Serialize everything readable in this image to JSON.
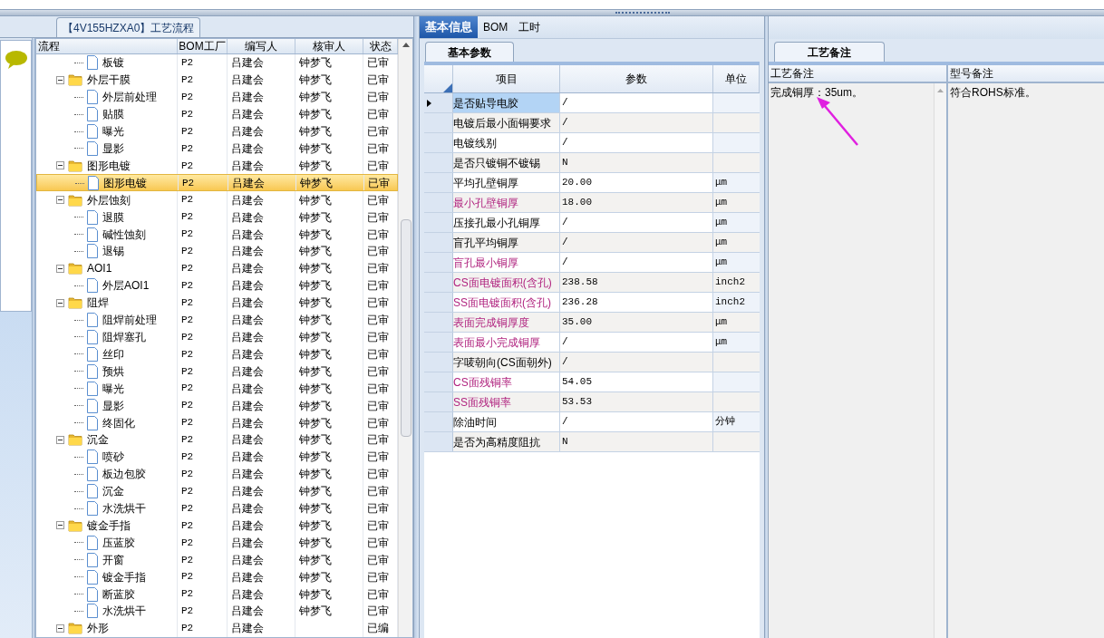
{
  "left_panel": {
    "title": "【4V155HZXA0】工艺流程",
    "columns": [
      "流程",
      "BOM工厂",
      "编写人",
      "核审人",
      "状态"
    ],
    "tree": [
      {
        "children": [
          {
            "label": "板镀",
            "factory": "P2",
            "writer": "吕建会",
            "reviewer": "钟梦飞",
            "status": "已审",
            "selected": false
          }
        ]
      },
      {
        "kind": "group",
        "label": "外层干膜",
        "factory": "P2",
        "writer": "吕建会",
        "reviewer": "钟梦飞",
        "status": "已审",
        "selected": false,
        "expanded": true,
        "children": [
          {
            "label": "外层前处理",
            "factory": "P2",
            "writer": "吕建会",
            "reviewer": "钟梦飞",
            "status": "已审",
            "selected": false
          },
          {
            "label": "贴膜",
            "factory": "P2",
            "writer": "吕建会",
            "reviewer": "钟梦飞",
            "status": "已审",
            "selected": false
          },
          {
            "label": "曝光",
            "factory": "P2",
            "writer": "吕建会",
            "reviewer": "钟梦飞",
            "status": "已审",
            "selected": false
          },
          {
            "label": "显影",
            "factory": "P2",
            "writer": "吕建会",
            "reviewer": "钟梦飞",
            "status": "已审",
            "selected": false
          }
        ]
      },
      {
        "kind": "group",
        "label": "图形电镀",
        "factory": "P2",
        "writer": "吕建会",
        "reviewer": "钟梦飞",
        "status": "已审",
        "selected": false,
        "expanded": true,
        "children": [
          {
            "label": "图形电镀",
            "factory": "P2",
            "writer": "吕建会",
            "reviewer": "钟梦飞",
            "status": "已审",
            "selected": true
          }
        ]
      },
      {
        "kind": "group",
        "label": "外层蚀刻",
        "factory": "P2",
        "writer": "吕建会",
        "reviewer": "钟梦飞",
        "status": "已审",
        "selected": false,
        "expanded": true,
        "children": [
          {
            "label": "退膜",
            "factory": "P2",
            "writer": "吕建会",
            "reviewer": "钟梦飞",
            "status": "已审",
            "selected": false
          },
          {
            "label": "碱性蚀刻",
            "factory": "P2",
            "writer": "吕建会",
            "reviewer": "钟梦飞",
            "status": "已审",
            "selected": false
          },
          {
            "label": "退锡",
            "factory": "P2",
            "writer": "吕建会",
            "reviewer": "钟梦飞",
            "status": "已审",
            "selected": false
          }
        ]
      },
      {
        "kind": "group",
        "label": "AOI1",
        "factory": "P2",
        "writer": "吕建会",
        "reviewer": "钟梦飞",
        "status": "已审",
        "selected": false,
        "expanded": true,
        "children": [
          {
            "label": "外层AOI1",
            "factory": "P2",
            "writer": "吕建会",
            "reviewer": "钟梦飞",
            "status": "已审",
            "selected": false
          }
        ]
      },
      {
        "kind": "group",
        "label": "阻焊",
        "factory": "P2",
        "writer": "吕建会",
        "reviewer": "钟梦飞",
        "status": "已审",
        "selected": false,
        "expanded": true,
        "children": [
          {
            "label": "阻焊前处理",
            "factory": "P2",
            "writer": "吕建会",
            "reviewer": "钟梦飞",
            "status": "已审",
            "selected": false
          },
          {
            "label": "阻焊塞孔",
            "factory": "P2",
            "writer": "吕建会",
            "reviewer": "钟梦飞",
            "status": "已审",
            "selected": false
          },
          {
            "label": "丝印",
            "factory": "P2",
            "writer": "吕建会",
            "reviewer": "钟梦飞",
            "status": "已审",
            "selected": false
          },
          {
            "label": "预烘",
            "factory": "P2",
            "writer": "吕建会",
            "reviewer": "钟梦飞",
            "status": "已审",
            "selected": false
          },
          {
            "label": "曝光",
            "factory": "P2",
            "writer": "吕建会",
            "reviewer": "钟梦飞",
            "status": "已审",
            "selected": false
          },
          {
            "label": "显影",
            "factory": "P2",
            "writer": "吕建会",
            "reviewer": "钟梦飞",
            "status": "已审",
            "selected": false
          },
          {
            "label": "终固化",
            "factory": "P2",
            "writer": "吕建会",
            "reviewer": "钟梦飞",
            "status": "已审",
            "selected": false
          }
        ]
      },
      {
        "kind": "group",
        "label": "沉金",
        "factory": "P2",
        "writer": "吕建会",
        "reviewer": "钟梦飞",
        "status": "已审",
        "selected": false,
        "expanded": true,
        "children": [
          {
            "label": "喷砂",
            "factory": "P2",
            "writer": "吕建会",
            "reviewer": "钟梦飞",
            "status": "已审",
            "selected": false
          },
          {
            "label": "板边包胶",
            "factory": "P2",
            "writer": "吕建会",
            "reviewer": "钟梦飞",
            "status": "已审",
            "selected": false
          },
          {
            "label": "沉金",
            "factory": "P2",
            "writer": "吕建会",
            "reviewer": "钟梦飞",
            "status": "已审",
            "selected": false
          },
          {
            "label": "水洗烘干",
            "factory": "P2",
            "writer": "吕建会",
            "reviewer": "钟梦飞",
            "status": "已审",
            "selected": false
          }
        ]
      },
      {
        "kind": "group",
        "label": "镀金手指",
        "factory": "P2",
        "writer": "吕建会",
        "reviewer": "钟梦飞",
        "status": "已审",
        "selected": false,
        "expanded": true,
        "children": [
          {
            "label": "压蓝胶",
            "factory": "P2",
            "writer": "吕建会",
            "reviewer": "钟梦飞",
            "status": "已审",
            "selected": false
          },
          {
            "label": "开窗",
            "factory": "P2",
            "writer": "吕建会",
            "reviewer": "钟梦飞",
            "status": "已审",
            "selected": false
          },
          {
            "label": "镀金手指",
            "factory": "P2",
            "writer": "吕建会",
            "reviewer": "钟梦飞",
            "status": "已审",
            "selected": false
          },
          {
            "label": "断蓝胶",
            "factory": "P2",
            "writer": "吕建会",
            "reviewer": "钟梦飞",
            "status": "已审",
            "selected": false
          },
          {
            "label": "水洗烘干",
            "factory": "P2",
            "writer": "吕建会",
            "reviewer": "钟梦飞",
            "status": "已审",
            "selected": false
          }
        ]
      },
      {
        "kind": "group",
        "label": "外形",
        "factory": "P2",
        "writer": "吕建会",
        "status": "已编",
        "selected": false,
        "expanded": true
      }
    ]
  },
  "middle_panel": {
    "tabs": [
      {
        "label": "基本信息",
        "selected": true
      },
      {
        "label": "BOM",
        "selected": false
      },
      {
        "label": "工时",
        "selected": false
      }
    ],
    "subtab": "基本参数",
    "columns": [
      "项目",
      "参数",
      "单位"
    ],
    "rows": [
      {
        "item": "是否贴导电胶",
        "value": "/",
        "selected": true,
        "important": false
      },
      {
        "item": "电镀后最小面铜要求",
        "value": "/",
        "selected": false,
        "important": false
      },
      {
        "item": "电镀线别",
        "value": "/",
        "selected": false,
        "important": false
      },
      {
        "item": "是否只镀铜不镀锡",
        "value": "N",
        "selected": false,
        "important": false
      },
      {
        "item": "平均孔壁铜厚",
        "value": "20.00",
        "unit": "μm",
        "selected": false,
        "important": false
      },
      {
        "item": "最小孔壁铜厚",
        "value": "18.00",
        "unit": "μm",
        "selected": false,
        "important": true
      },
      {
        "item": "压接孔最小孔铜厚",
        "value": "/",
        "unit": "μm",
        "selected": false,
        "important": false
      },
      {
        "item": "盲孔平均铜厚",
        "value": "/",
        "unit": "μm",
        "selected": false,
        "important": false
      },
      {
        "item": "盲孔最小铜厚",
        "value": "/",
        "unit": "μm",
        "selected": false,
        "important": true
      },
      {
        "item": "CS面电镀面积(含孔)",
        "value": "238.58",
        "unit": "inch2",
        "selected": false,
        "important": true
      },
      {
        "item": "SS面电镀面积(含孔)",
        "value": "236.28",
        "unit": "inch2",
        "selected": false,
        "important": true
      },
      {
        "item": "表面完成铜厚度",
        "value": "35.00",
        "unit": "μm",
        "selected": false,
        "important": true
      },
      {
        "item": "表面最小完成铜厚",
        "value": "/",
        "unit": "μm",
        "selected": false,
        "important": true
      },
      {
        "item": "字唛朝向(CS面朝外)",
        "value": "/",
        "selected": false,
        "important": false
      },
      {
        "item": "CS面残铜率",
        "value": "54.05",
        "selected": false,
        "important": true
      },
      {
        "item": "SS面残铜率",
        "value": "53.53",
        "selected": false,
        "important": true
      },
      {
        "item": "除油时间",
        "value": "/",
        "unit": "分钟",
        "selected": false,
        "important": false
      },
      {
        "item": "是否为高精度阻抗",
        "value": "N",
        "selected": false,
        "important": false
      }
    ]
  },
  "right_panel": {
    "tab": "工艺备注",
    "columns": [
      {
        "header": "工艺备注",
        "text": "完成铜厚：35um。"
      },
      {
        "header": "型号备注",
        "text": "符合ROHS标准。"
      }
    ]
  }
}
